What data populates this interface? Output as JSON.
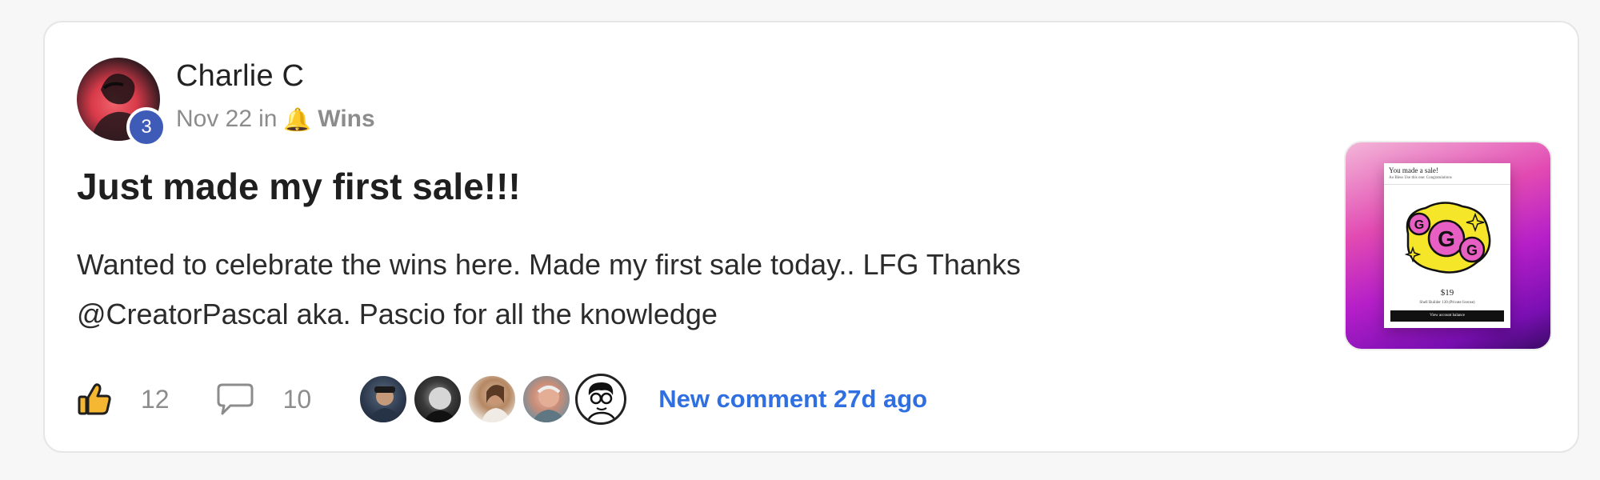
{
  "post": {
    "author": {
      "name": "Charlie C",
      "level": "3"
    },
    "meta": {
      "date": "Nov 22",
      "in_label": "in",
      "category_icon": "bell-icon",
      "category": "Wins"
    },
    "title": "Just made my first sale!!!",
    "body_line_1": "Wanted to celebrate the wins here. Made my first sale today.. LFG Thanks",
    "body_line_2": "@CreatorPascal aka. Pascio for all the knowledge",
    "likes": {
      "icon": "thumbs-up-icon",
      "count": "12"
    },
    "comments": {
      "icon": "comment-icon",
      "count": "10"
    },
    "commenters": [
      {
        "name": "commenter-avatar-1"
      },
      {
        "name": "commenter-avatar-2"
      },
      {
        "name": "commenter-avatar-3"
      },
      {
        "name": "commenter-avatar-4"
      },
      {
        "name": "commenter-avatar-5"
      }
    ],
    "last_activity": "New comment 27d ago"
  },
  "thumbnail": {
    "receipt_title": "You made a sale!",
    "receipt_subtitle": "Ao Bless Use this one: Congratulations",
    "price": "$19",
    "product": "Shell Builder 130 (Private license)",
    "button": "View account balance"
  },
  "colors": {
    "link": "#2f6fe0",
    "badge": "#3e5bb8",
    "muted": "#8c8c8c",
    "category_bell": "#e3a520"
  }
}
